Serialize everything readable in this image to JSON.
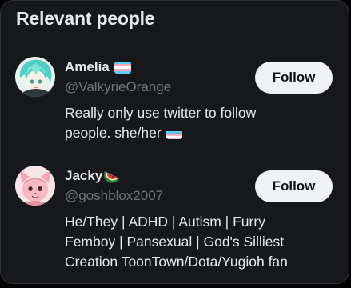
{
  "section": {
    "title": "Relevant people"
  },
  "people": [
    {
      "display_name": "Amelia",
      "name_icon": "transgender-flag-emoji",
      "handle": "@ValkyrieOrange",
      "bio_lines": [
        "Really only use twitter to follow",
        "people. she/her"
      ],
      "bio_icon": "transgender-flag-emoji",
      "follow_label": "Follow"
    },
    {
      "display_name": "Jacky",
      "name_icon": "watermelon-emoji",
      "handle": "@goshblox2007",
      "bio_lines": [
        "He/They | ADHD | Autism | Furry",
        "Femboy | Pansexual | God's Silliest",
        "Creation ToonTown/Dota/Yugioh fan"
      ],
      "follow_label": "Follow"
    }
  ],
  "colors": {
    "page_background": "#000000",
    "panel_background": "#16181c",
    "primary_text": "#e7e9ea",
    "secondary_text": "#71767b",
    "follow_button_background": "#eff3f4",
    "follow_button_text": "#0f1419",
    "trans_blue": "#5bcefa",
    "trans_pink": "#f5a9b8",
    "trans_white": "#ffffff"
  }
}
